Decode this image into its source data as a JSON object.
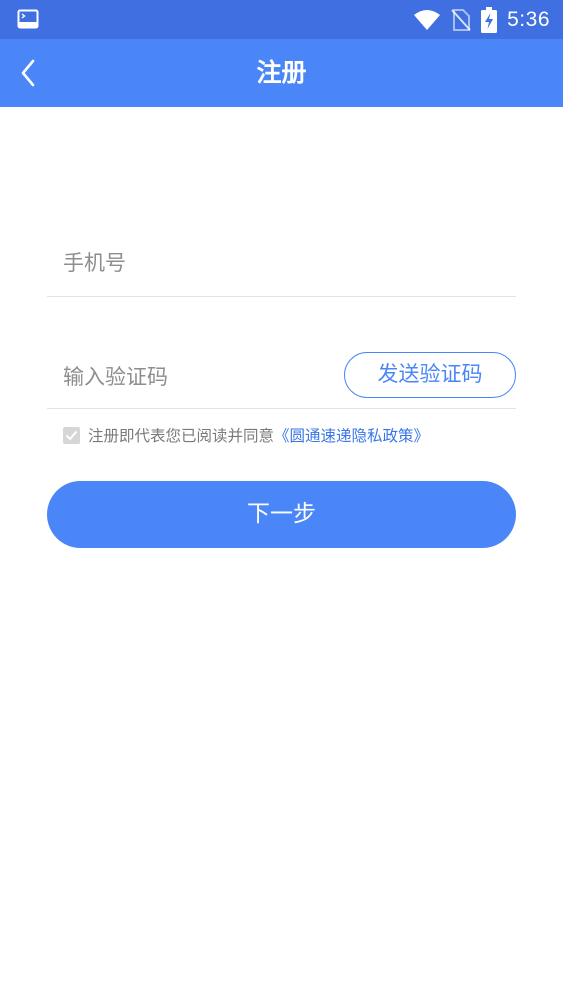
{
  "status_bar": {
    "time": "5:36",
    "icons": [
      "terminal-app-icon",
      "wifi-icon",
      "no-sim-icon",
      "battery-charging-icon"
    ]
  },
  "header": {
    "title": "注册",
    "back_icon": "chevron-left-icon"
  },
  "form": {
    "phone": {
      "placeholder": "手机号",
      "value": ""
    },
    "code": {
      "placeholder": "输入验证码",
      "value": ""
    },
    "send_code_label": "发送验证码",
    "agreement": {
      "checked": true,
      "text": "注册即代表您已阅读并同意",
      "link": "《圆通速递隐私政策》"
    },
    "next_label": "下一步"
  },
  "colors": {
    "status_bar": "#3f6fe0",
    "primary": "#4a86f7",
    "link": "#3a76e8",
    "placeholder": "#8e8e8e",
    "divider": "#e3e3e3"
  }
}
